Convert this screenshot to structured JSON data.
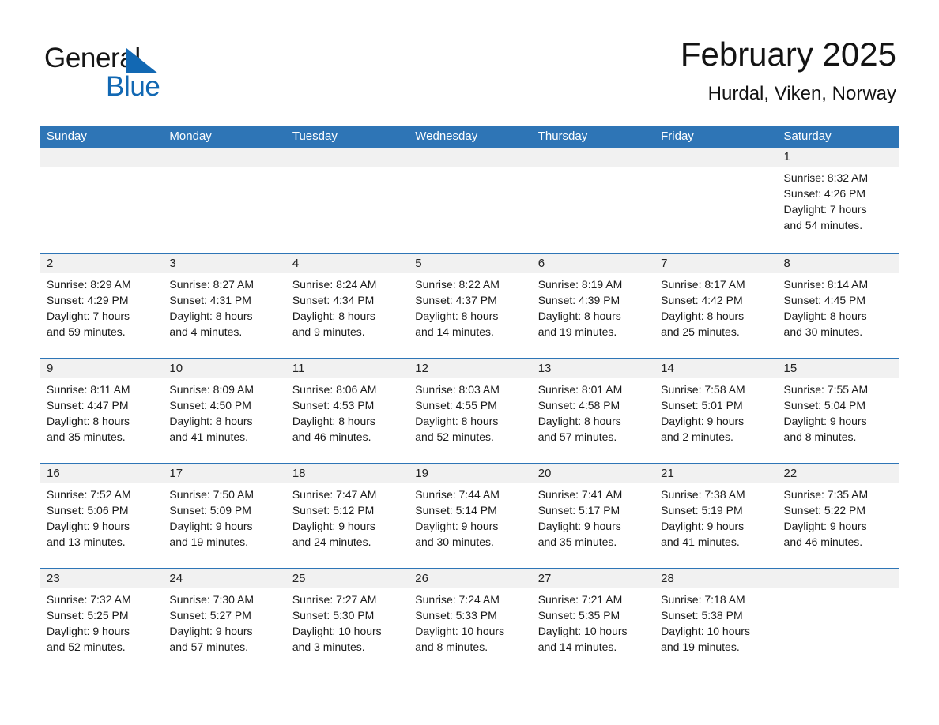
{
  "brand": {
    "word1": "General",
    "word2": "Blue",
    "triangle_color": "#1268b3"
  },
  "header": {
    "title": "February 2025",
    "subtitle": "Hurdal, Viken, Norway"
  },
  "theme": {
    "accent": "#2e75b6",
    "day_band": "#f1f1f1",
    "text": "#1a1a1a"
  },
  "calendar": {
    "weekday_headers": [
      "Sunday",
      "Monday",
      "Tuesday",
      "Wednesday",
      "Thursday",
      "Friday",
      "Saturday"
    ],
    "weeks": [
      [
        {
          "day": "",
          "lines": []
        },
        {
          "day": "",
          "lines": []
        },
        {
          "day": "",
          "lines": []
        },
        {
          "day": "",
          "lines": []
        },
        {
          "day": "",
          "lines": []
        },
        {
          "day": "",
          "lines": []
        },
        {
          "day": "1",
          "lines": [
            "Sunrise: 8:32 AM",
            "Sunset: 4:26 PM",
            "Daylight: 7 hours",
            "and 54 minutes."
          ]
        }
      ],
      [
        {
          "day": "2",
          "lines": [
            "Sunrise: 8:29 AM",
            "Sunset: 4:29 PM",
            "Daylight: 7 hours",
            "and 59 minutes."
          ]
        },
        {
          "day": "3",
          "lines": [
            "Sunrise: 8:27 AM",
            "Sunset: 4:31 PM",
            "Daylight: 8 hours",
            "and 4 minutes."
          ]
        },
        {
          "day": "4",
          "lines": [
            "Sunrise: 8:24 AM",
            "Sunset: 4:34 PM",
            "Daylight: 8 hours",
            "and 9 minutes."
          ]
        },
        {
          "day": "5",
          "lines": [
            "Sunrise: 8:22 AM",
            "Sunset: 4:37 PM",
            "Daylight: 8 hours",
            "and 14 minutes."
          ]
        },
        {
          "day": "6",
          "lines": [
            "Sunrise: 8:19 AM",
            "Sunset: 4:39 PM",
            "Daylight: 8 hours",
            "and 19 minutes."
          ]
        },
        {
          "day": "7",
          "lines": [
            "Sunrise: 8:17 AM",
            "Sunset: 4:42 PM",
            "Daylight: 8 hours",
            "and 25 minutes."
          ]
        },
        {
          "day": "8",
          "lines": [
            "Sunrise: 8:14 AM",
            "Sunset: 4:45 PM",
            "Daylight: 8 hours",
            "and 30 minutes."
          ]
        }
      ],
      [
        {
          "day": "9",
          "lines": [
            "Sunrise: 8:11 AM",
            "Sunset: 4:47 PM",
            "Daylight: 8 hours",
            "and 35 minutes."
          ]
        },
        {
          "day": "10",
          "lines": [
            "Sunrise: 8:09 AM",
            "Sunset: 4:50 PM",
            "Daylight: 8 hours",
            "and 41 minutes."
          ]
        },
        {
          "day": "11",
          "lines": [
            "Sunrise: 8:06 AM",
            "Sunset: 4:53 PM",
            "Daylight: 8 hours",
            "and 46 minutes."
          ]
        },
        {
          "day": "12",
          "lines": [
            "Sunrise: 8:03 AM",
            "Sunset: 4:55 PM",
            "Daylight: 8 hours",
            "and 52 minutes."
          ]
        },
        {
          "day": "13",
          "lines": [
            "Sunrise: 8:01 AM",
            "Sunset: 4:58 PM",
            "Daylight: 8 hours",
            "and 57 minutes."
          ]
        },
        {
          "day": "14",
          "lines": [
            "Sunrise: 7:58 AM",
            "Sunset: 5:01 PM",
            "Daylight: 9 hours",
            "and 2 minutes."
          ]
        },
        {
          "day": "15",
          "lines": [
            "Sunrise: 7:55 AM",
            "Sunset: 5:04 PM",
            "Daylight: 9 hours",
            "and 8 minutes."
          ]
        }
      ],
      [
        {
          "day": "16",
          "lines": [
            "Sunrise: 7:52 AM",
            "Sunset: 5:06 PM",
            "Daylight: 9 hours",
            "and 13 minutes."
          ]
        },
        {
          "day": "17",
          "lines": [
            "Sunrise: 7:50 AM",
            "Sunset: 5:09 PM",
            "Daylight: 9 hours",
            "and 19 minutes."
          ]
        },
        {
          "day": "18",
          "lines": [
            "Sunrise: 7:47 AM",
            "Sunset: 5:12 PM",
            "Daylight: 9 hours",
            "and 24 minutes."
          ]
        },
        {
          "day": "19",
          "lines": [
            "Sunrise: 7:44 AM",
            "Sunset: 5:14 PM",
            "Daylight: 9 hours",
            "and 30 minutes."
          ]
        },
        {
          "day": "20",
          "lines": [
            "Sunrise: 7:41 AM",
            "Sunset: 5:17 PM",
            "Daylight: 9 hours",
            "and 35 minutes."
          ]
        },
        {
          "day": "21",
          "lines": [
            "Sunrise: 7:38 AM",
            "Sunset: 5:19 PM",
            "Daylight: 9 hours",
            "and 41 minutes."
          ]
        },
        {
          "day": "22",
          "lines": [
            "Sunrise: 7:35 AM",
            "Sunset: 5:22 PM",
            "Daylight: 9 hours",
            "and 46 minutes."
          ]
        }
      ],
      [
        {
          "day": "23",
          "lines": [
            "Sunrise: 7:32 AM",
            "Sunset: 5:25 PM",
            "Daylight: 9 hours",
            "and 52 minutes."
          ]
        },
        {
          "day": "24",
          "lines": [
            "Sunrise: 7:30 AM",
            "Sunset: 5:27 PM",
            "Daylight: 9 hours",
            "and 57 minutes."
          ]
        },
        {
          "day": "25",
          "lines": [
            "Sunrise: 7:27 AM",
            "Sunset: 5:30 PM",
            "Daylight: 10 hours",
            "and 3 minutes."
          ]
        },
        {
          "day": "26",
          "lines": [
            "Sunrise: 7:24 AM",
            "Sunset: 5:33 PM",
            "Daylight: 10 hours",
            "and 8 minutes."
          ]
        },
        {
          "day": "27",
          "lines": [
            "Sunrise: 7:21 AM",
            "Sunset: 5:35 PM",
            "Daylight: 10 hours",
            "and 14 minutes."
          ]
        },
        {
          "day": "28",
          "lines": [
            "Sunrise: 7:18 AM",
            "Sunset: 5:38 PM",
            "Daylight: 10 hours",
            "and 19 minutes."
          ]
        },
        {
          "day": "",
          "lines": []
        }
      ]
    ]
  }
}
